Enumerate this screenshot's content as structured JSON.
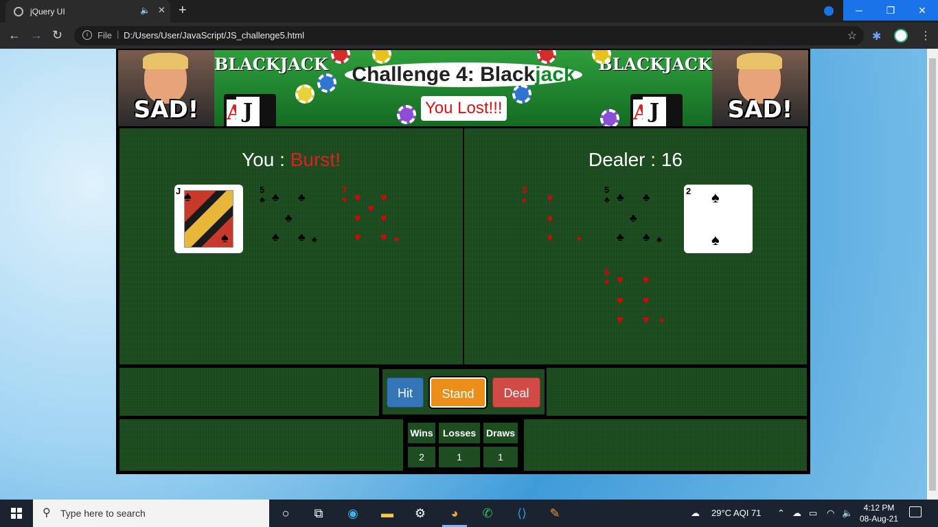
{
  "browser": {
    "tab_title": "jQuery UI",
    "tab_audio": "🔈",
    "tab_close": "✕",
    "new_tab": "+",
    "file_label": "File",
    "url": "D:/Users/User/JavaScript/JS_challenge5.html",
    "window_min": "─",
    "window_max": "❐",
    "window_close": "✕",
    "back": "←",
    "forward": "→",
    "reload": "↻",
    "star": "☆",
    "menu": "⋮",
    "extensions": "✱"
  },
  "game": {
    "banner": {
      "left_word": "BLACKJACK",
      "right_word": "BLACKJACK",
      "sad_text": "SAD!",
      "card_a": "A",
      "card_j": "J"
    },
    "title_main": "Challenge 4: Black",
    "title_accent": "jack",
    "result_text": "You Lost!!!",
    "you_label": "You : ",
    "you_status": "Burst!",
    "dealer_label": "Dealer : ",
    "dealer_score": "16",
    "player_cards": [
      {
        "rank": "J",
        "suit": "spades"
      },
      {
        "rank": "5",
        "suit": "clubs"
      },
      {
        "rank": "7",
        "suit": "hearts"
      }
    ],
    "dealer_cards": [
      {
        "rank": "3",
        "suit": "diamonds"
      },
      {
        "rank": "5",
        "suit": "clubs"
      },
      {
        "rank": "2",
        "suit": "spades"
      },
      {
        "rank": "6",
        "suit": "hearts"
      }
    ],
    "buttons": {
      "hit": "Hit",
      "stand": "Stand",
      "deal": "Deal"
    },
    "score_headers": {
      "wins": "Wins",
      "losses": "Losses",
      "draws": "Draws"
    },
    "scores": {
      "wins": "2",
      "losses": "1",
      "draws": "1"
    }
  },
  "taskbar": {
    "search_placeholder": "Type here to search",
    "weather": "29°C  AQI 71",
    "time": "4:12 PM",
    "date": "08-Aug-21"
  },
  "colors": {
    "felt": "#1e4d22",
    "result_red": "#e01010",
    "title_green": "#0f8c25",
    "hit": "#3375b6",
    "stand": "#eb8f1a",
    "deal": "#d24a45"
  }
}
